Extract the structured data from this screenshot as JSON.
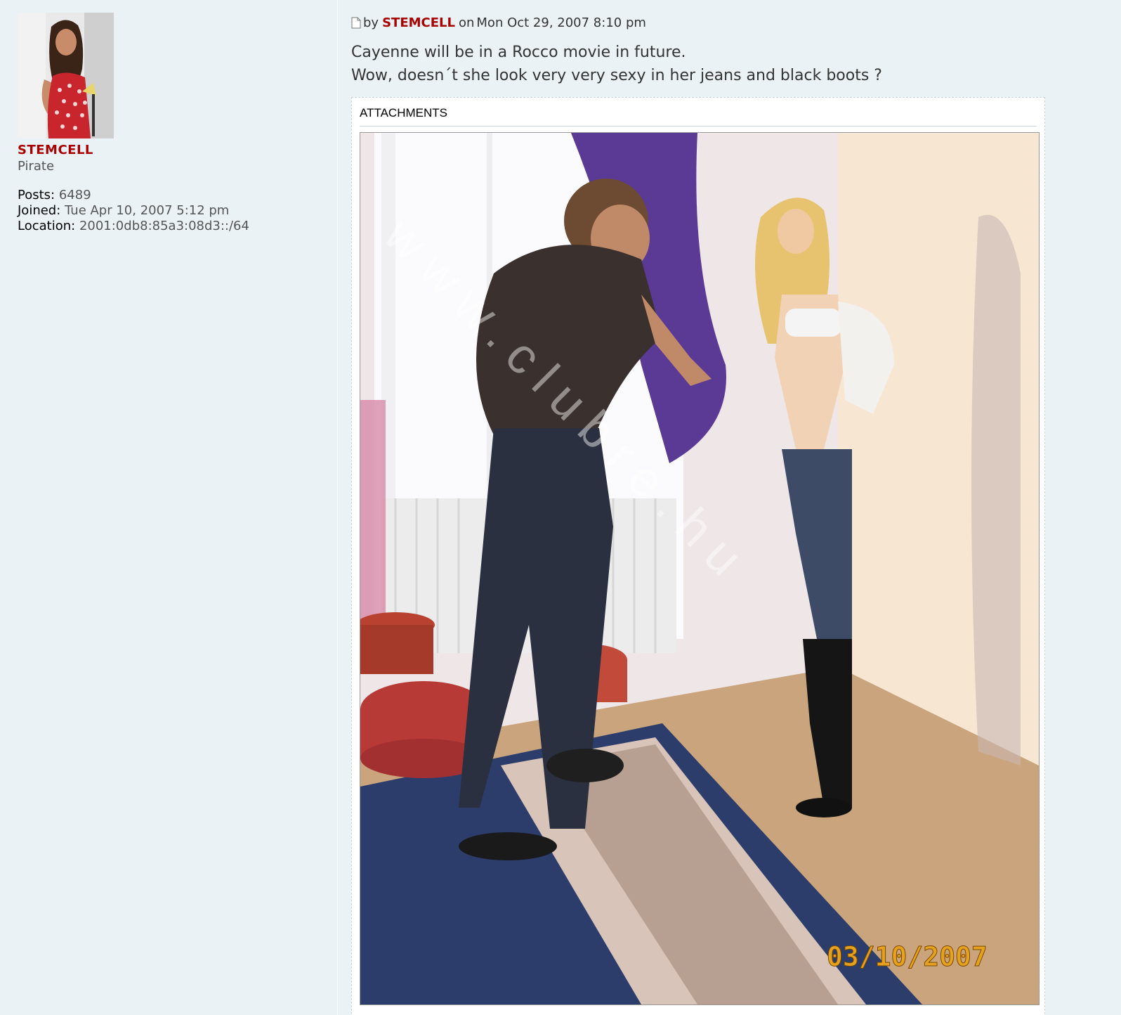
{
  "profile": {
    "username": "STEMCELL",
    "rank": "Pirate",
    "posts_label": "Posts:",
    "posts_value": "6489",
    "joined_label": "Joined:",
    "joined_value": "Tue Apr 10, 2007 5:12 pm",
    "location_label": "Location:",
    "location_value": "2001:0db8:85a3:08d3::/64"
  },
  "post": {
    "by_label": "by",
    "author": "STEMCELL",
    "on_label": "on",
    "date": "Mon Oct 29, 2007 8:10 pm",
    "lines": [
      "Cayenne will be in a Rocco movie in future.",
      "Wow, doesn´t she look very very sexy in her jeans and black boots ?"
    ],
    "attachments_label": "ATTACHMENTS",
    "photo_date": "03/10/2007"
  }
}
